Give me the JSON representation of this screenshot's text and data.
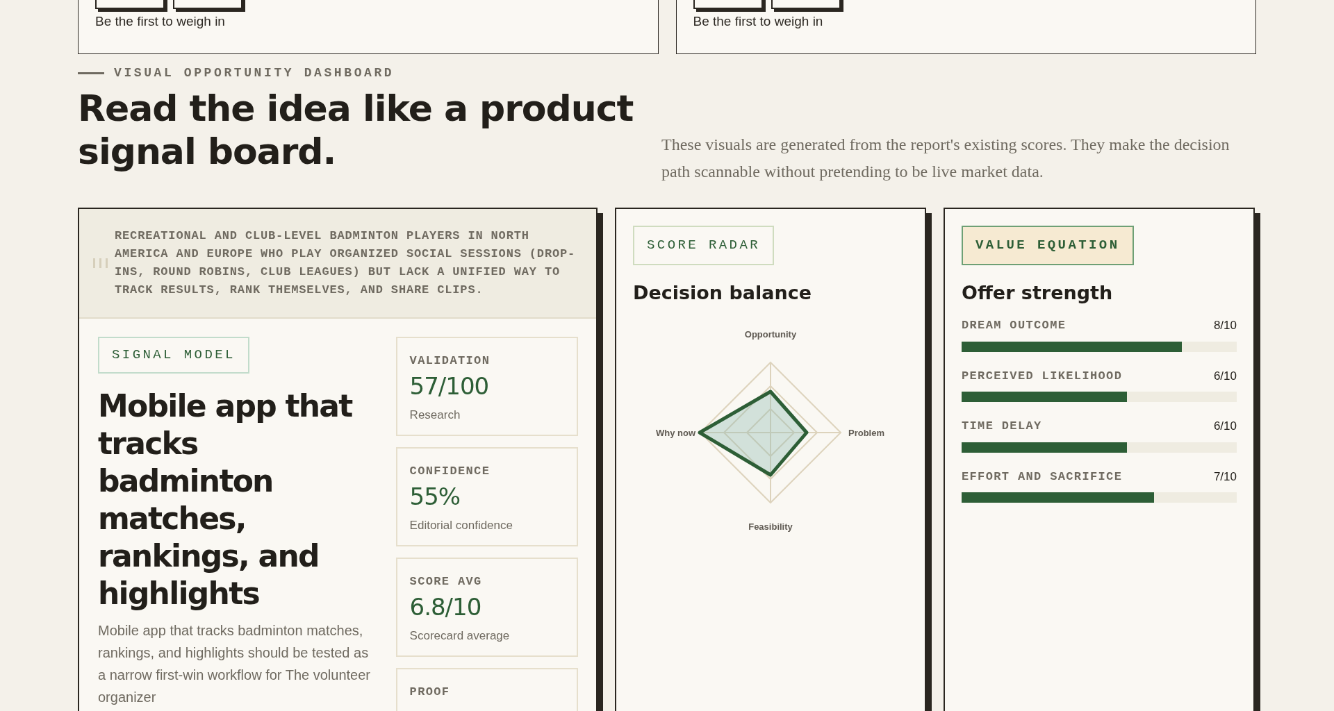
{
  "top_cards": [
    {
      "prompt": "Be the first to weigh in"
    },
    {
      "prompt": "Be the first to weigh in"
    }
  ],
  "section": {
    "eyebrow": "VISUAL OPPORTUNITY DASHBOARD",
    "title": "Read the idea like a product signal board.",
    "intro": "These visuals are generated from the report's existing scores. They make the decision path scannable without pretending to be live market data."
  },
  "signal_card": {
    "audience": "RECREATIONAL AND CLUB-LEVEL BADMINTON PLAYERS IN NORTH AMERICA AND EUROPE WHO PLAY ORGANIZED SOCIAL SESSIONS (DROP-INS, ROUND ROBINS, CLUB LEAGUES) BUT LACK A UNIFIED WAY TO TRACK RESULTS, RANK THEMSELVES, AND SHARE CLIPS.",
    "tag": "SIGNAL MODEL",
    "title": "Mobile app that tracks badminton matches, rankings, and highlights",
    "summary": "Mobile app that tracks badminton matches, rankings, and highlights should be tested as a narrow first-win workflow for The volunteer organizer",
    "metrics": [
      {
        "label": "VALIDATION",
        "value": "57/100",
        "caption": "Research"
      },
      {
        "label": "CONFIDENCE",
        "value": "55%",
        "caption": "Editorial confidence"
      },
      {
        "label": "SCORE AVG",
        "value": "6.8/10",
        "caption": "Scorecard average"
      },
      {
        "label": "PROOF"
      }
    ]
  },
  "radar_card": {
    "tag": "SCORE RADAR",
    "title": "Decision balance",
    "axes": [
      "Opportunity",
      "Problem",
      "Feasibility",
      "Why now"
    ]
  },
  "value_card": {
    "tag": "VALUE EQUATION",
    "title": "Offer strength",
    "bars": [
      {
        "label": "DREAM OUTCOME",
        "reading": "8/10",
        "level": 0.8
      },
      {
        "label": "PERCEIVED LIKELIHOOD",
        "reading": "6/10",
        "level": 0.6
      },
      {
        "label": "TIME DELAY",
        "reading": "6/10",
        "level": 0.6
      },
      {
        "label": "EFFORT AND SACRIFICE",
        "reading": "7/10",
        "level": 0.7
      }
    ]
  }
}
